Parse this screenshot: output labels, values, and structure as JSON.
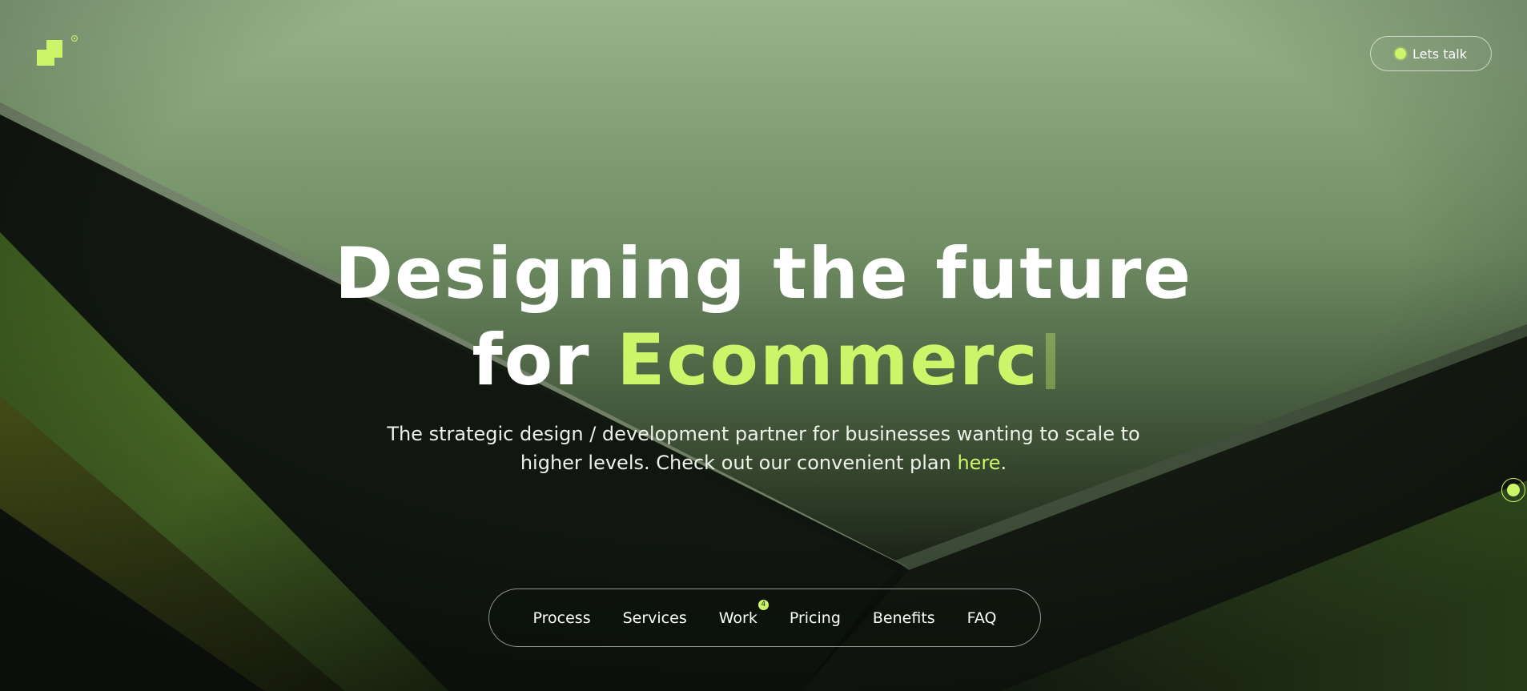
{
  "brand": {
    "accent_color": "#cdf56a",
    "logo_icon": "logo-icon"
  },
  "header": {
    "cta_label": "Lets talk",
    "cta_icon": "status-dot-icon"
  },
  "hero": {
    "title_line1": "Designing the future",
    "title_line2_prefix": "for ",
    "title_line2_accent": "Ecommerc",
    "subtitle_line1": "The strategic design / development partner for businesses wanting to scale to",
    "subtitle_line2_prefix": "higher levels. Check out our convenient plan ",
    "subtitle_link": "here",
    "subtitle_line2_suffix": "."
  },
  "nav": {
    "items": [
      {
        "label": "Process"
      },
      {
        "label": "Services"
      },
      {
        "label": "Work",
        "badge": "4"
      },
      {
        "label": "Pricing"
      },
      {
        "label": "Benefits"
      },
      {
        "label": "FAQ"
      }
    ]
  },
  "side": {
    "icon": "scroll-indicator-icon"
  }
}
